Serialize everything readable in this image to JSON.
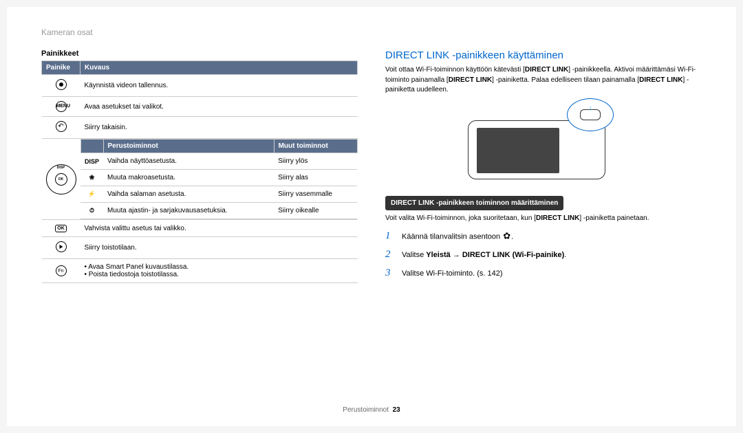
{
  "breadcrumb": "Kameran osat",
  "left": {
    "heading": "Painikkeet",
    "table": {
      "headers": {
        "button": "Painike",
        "desc": "Kuvaus"
      },
      "rows": {
        "record": "Käynnistä videon tallennus.",
        "menu_label": "MENU",
        "menu": "Avaa asetukset tai valikot.",
        "back": "Siirry takaisin.",
        "ok_label": "OK",
        "ok": "Vahvista valittu asetus tai valikko.",
        "play": "Siirry toistotilaan.",
        "fn_label": "Fn",
        "fn1": "Avaa Smart Panel kuvaustilassa.",
        "fn2": "Poista tiedostoja toistotilassa."
      },
      "sub": {
        "headers": {
          "blank": "",
          "basic": "Perustoiminnot",
          "other": "Muut toiminnot"
        },
        "rows": {
          "disp_label": "DISP",
          "disp_basic": "Vaihda näyttöasetusta.",
          "disp_other": "Siirry ylös",
          "macro_basic": "Muuta makroasetusta.",
          "macro_other": "Siirry alas",
          "flash_basic": "Vaihda salaman asetusta.",
          "flash_other": "Siirry vasemmalle",
          "timer_basic": "Muuta ajastin- ja sarjakuvausasetuksia.",
          "timer_other": "Siirry oikealle"
        },
        "navpad": {
          "top": "DISP",
          "center": "OK"
        }
      }
    }
  },
  "right": {
    "title": "DIRECT LINK -painikkeen käyttäminen",
    "para_pre": "Voit ottaa Wi-Fi-toiminnon käyttöön kätevästi [",
    "bold1": "DIRECT LINK",
    "para_mid1": "] -painikkeella. Aktivoi määrittämäsi Wi-Fi-toiminto painamalla [",
    "bold2": "DIRECT LINK",
    "para_mid2": "] -painiketta. Palaa edelliseen tilaan painamalla [",
    "bold3": "DIRECT LINK",
    "para_post": "] -painiketta uudelleen.",
    "subbar": "DIRECT LINK -painikkeen toiminnon määrittäminen",
    "inst_pre": "Voit valita Wi-Fi-toiminnon, joka suoritetaan, kun [",
    "inst_bold": "DIRECT LINK",
    "inst_post": "] -painiketta painetaan.",
    "steps": {
      "s1": "Käännä tilanvalitsin asentoon ",
      "s2_pre": "Valitse ",
      "s2_bold": "Yleistä → DIRECT LINK (Wi-Fi-painike)",
      "s2_post": ".",
      "s3": "Valitse Wi-Fi-toiminto. (s. 142)"
    }
  },
  "footer": {
    "section": "Perustoiminnot",
    "page": "23"
  }
}
